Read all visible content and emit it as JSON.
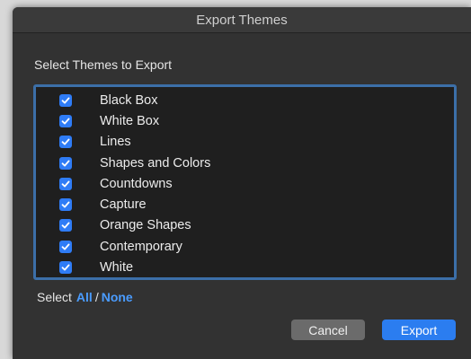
{
  "window": {
    "title": "Export Themes"
  },
  "heading": "Select Themes to Export",
  "themes": [
    {
      "label": "Black Box",
      "checked": true
    },
    {
      "label": "White Box",
      "checked": true
    },
    {
      "label": "Lines",
      "checked": true
    },
    {
      "label": "Shapes and Colors",
      "checked": true
    },
    {
      "label": "Countdowns",
      "checked": true
    },
    {
      "label": "Capture",
      "checked": true
    },
    {
      "label": "Orange Shapes",
      "checked": true
    },
    {
      "label": "Contemporary",
      "checked": true
    },
    {
      "label": "White",
      "checked": true
    }
  ],
  "select": {
    "prefix": "Select",
    "all": "All",
    "separator": "/",
    "none": "None"
  },
  "buttons": {
    "cancel": "Cancel",
    "export": "Export"
  },
  "colors": {
    "accent": "#2f7cf6",
    "link": "#4a9cff",
    "list_background": "#1f1f1f",
    "window_background": "#323232"
  }
}
